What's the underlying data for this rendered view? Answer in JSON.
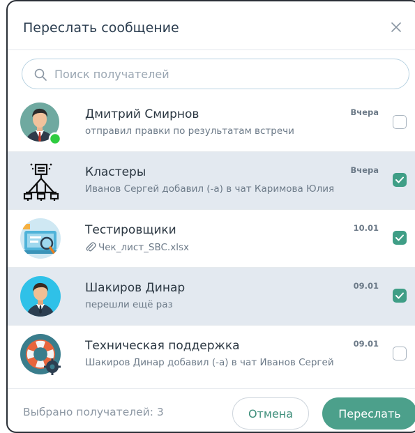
{
  "dialog": {
    "title": "Переслать сообщение",
    "close_icon": "close-icon"
  },
  "search": {
    "placeholder": "Поиск получателей",
    "icon": "search-icon"
  },
  "recipients": [
    {
      "name": "Дмитрий Смирнов",
      "subtitle": "отправил правки по результатам встречи",
      "date": "Вчера",
      "selected": false,
      "online": true,
      "avatar": "businessman-avatar"
    },
    {
      "name": "Кластеры",
      "subtitle": "Иванов Сергей добавил (-а) в чат Каримова Юлия",
      "date": "Вчера",
      "selected": true,
      "avatar": "network-cluster-icon"
    },
    {
      "name": "Тестировщики",
      "subtitle": "Чек_лист_SBC.xlsx",
      "subtitle_icon": "paperclip-icon",
      "date": "10.01",
      "selected": true,
      "avatar": "testing-laptop-avatar"
    },
    {
      "name": "Шакиров Динар",
      "subtitle": "перешли ещё раз",
      "date": "09.01",
      "selected": true,
      "avatar": "user-avatar"
    },
    {
      "name": "Техническая поддержка",
      "subtitle": "Шакиров Динар добавил (-а) в чат Иванов Сергей",
      "date": "09.01",
      "selected": false,
      "avatar": "lifebuoy-gear-avatar"
    }
  ],
  "footer": {
    "selected_count": "Выбрано получателей: 3",
    "cancel_label": "Отмена",
    "forward_label": "Переслать"
  },
  "colors": {
    "accent": "#4ca08b",
    "checked": "#3f9e86",
    "selected_row": "#e3e9f0",
    "online": "#2ecc40"
  }
}
